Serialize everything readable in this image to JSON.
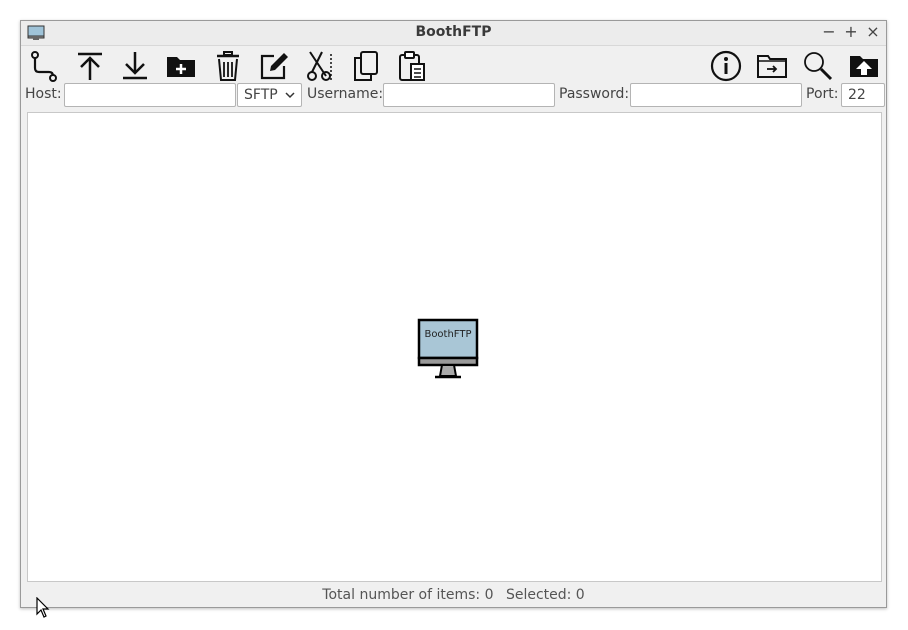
{
  "window": {
    "title": "BoothFTP",
    "controls": {
      "minimize": "−",
      "maximize": "+",
      "close": "×"
    }
  },
  "toolbar": {
    "left_buttons": [
      {
        "icon": "connect-icon"
      },
      {
        "icon": "upload-icon"
      },
      {
        "icon": "download-icon"
      },
      {
        "icon": "new-folder-icon"
      },
      {
        "icon": "delete-icon"
      },
      {
        "icon": "rename-icon"
      },
      {
        "icon": "cut-icon"
      },
      {
        "icon": "copy-icon"
      },
      {
        "icon": "paste-icon"
      }
    ],
    "right_buttons": [
      {
        "icon": "info-icon"
      },
      {
        "icon": "go-to-folder-icon"
      },
      {
        "icon": "search-icon"
      },
      {
        "icon": "parent-folder-icon"
      }
    ]
  },
  "connection": {
    "host_label": "Host:",
    "host_value": "",
    "protocol": "SFTP",
    "username_label": "Username:",
    "username_value": "",
    "password_label": "Password:",
    "password_value": "",
    "port_label": "Port:",
    "port_value": "22"
  },
  "content": {
    "placeholder_icon": "monitor-icon",
    "placeholder_text": "BoothFTP"
  },
  "status": {
    "total": "Total number of items: 0",
    "selected": "Selected: 0"
  }
}
